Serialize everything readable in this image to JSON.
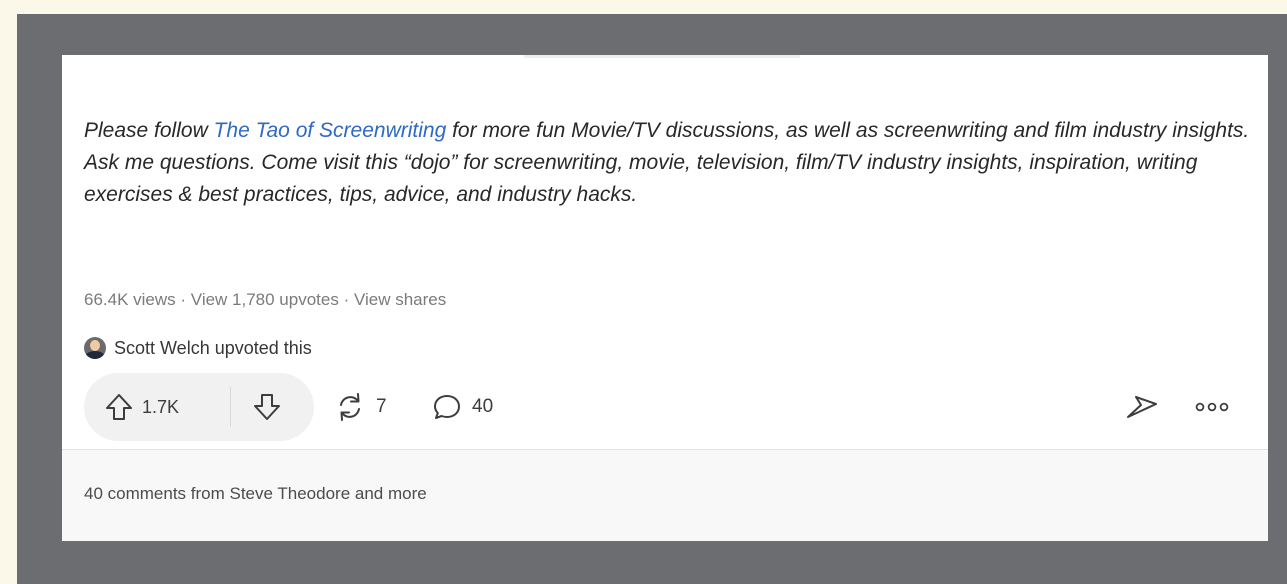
{
  "post": {
    "text_before_link": "Please follow ",
    "link_text": "The Tao of Screenwriting",
    "text_after_link": " for more fun Movie/TV discussions, as well as screenwriting and film industry insights. Ask me questions. Come visit this “dojo” for screenwriting, movie, television, film/TV industry insights, inspiration, writing exercises & best practices, tips, advice, and industry hacks."
  },
  "meta": {
    "views": "66.4K views",
    "sep1": " · ",
    "upvotes_link": "View 1,780 upvotes",
    "sep2": " · ",
    "shares_link": "View shares"
  },
  "upvoted_by": {
    "text": "Scott Welch upvoted this"
  },
  "actions": {
    "upvote_count": "1.7K",
    "share_count": "7",
    "comment_count": "40"
  },
  "comments": {
    "summary": "40 comments from Steve Theodore and more"
  },
  "colors": {
    "link": "#2e69c4",
    "background": "#fbf8ea",
    "frame": "#6c6d70"
  },
  "icons": {
    "upvote": "arrow-up-icon",
    "downvote": "arrow-down-icon",
    "share": "refresh-icon",
    "comment": "comment-bubble-icon",
    "send": "send-arrow-icon",
    "more": "more-dots-icon"
  }
}
